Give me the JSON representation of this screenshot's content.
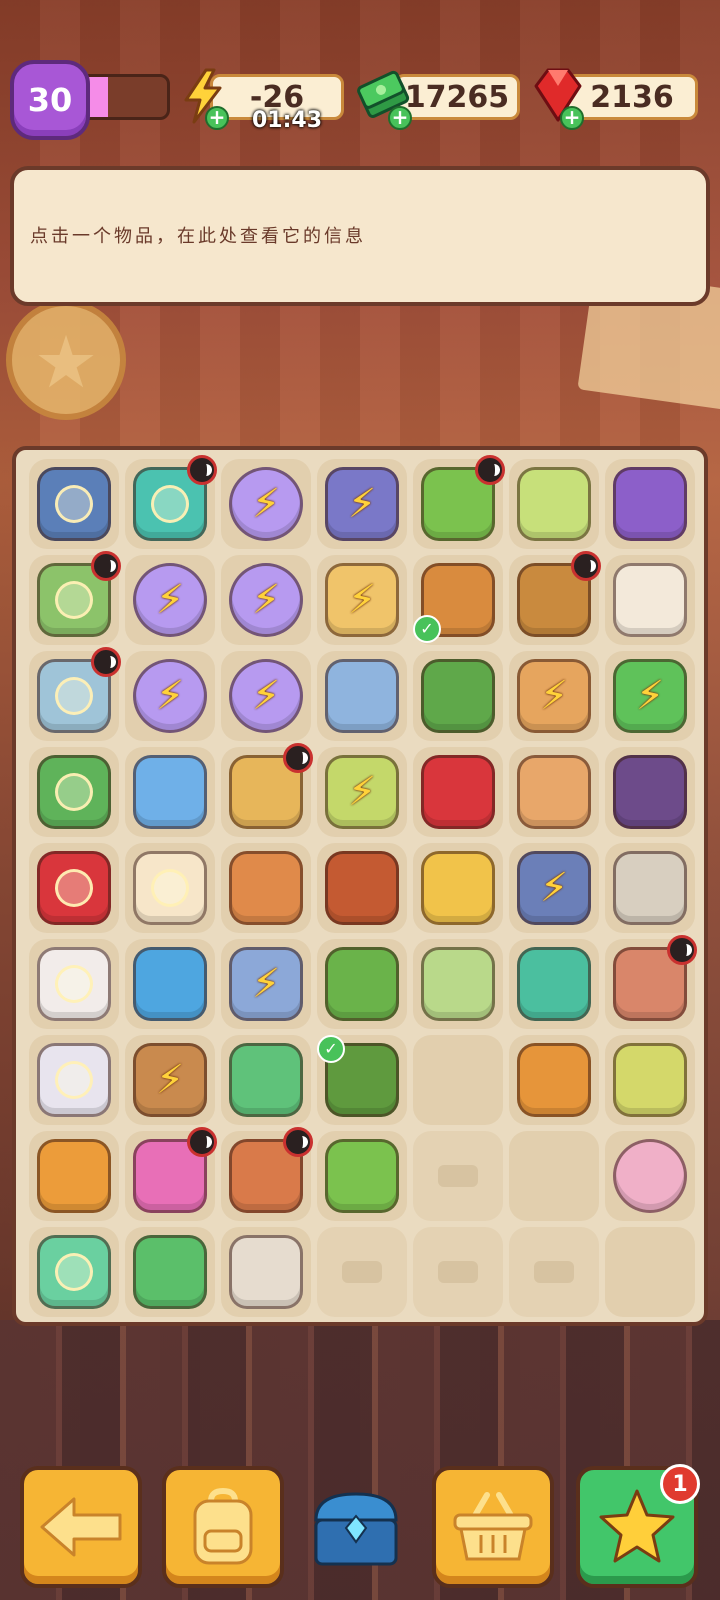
{
  "hud": {
    "level": "30",
    "level_progress": 0.3,
    "energy": "-26",
    "energy_timer": "01:43",
    "cash": "17265",
    "gems": "2136"
  },
  "info": {
    "text": "点击一个物品，在此处查看它的信息"
  },
  "board": {
    "rows": [
      [
        {
          "icon": "truck-icon",
          "color": "#5b7fb8",
          "glow": true
        },
        {
          "icon": "medkit-icon",
          "color": "#4bc2b0",
          "glow": true,
          "lock": true
        },
        {
          "icon": "energy-orb-icon",
          "color": "#b79af0",
          "round": true
        },
        {
          "icon": "energy-crate-icon",
          "color": "#7a78c8"
        },
        {
          "icon": "plant-pot-icon",
          "color": "#7bc24e",
          "lock": true
        },
        {
          "icon": "detergent-bottle-icon",
          "color": "#c7e07a"
        },
        {
          "icon": "spotlight-icon",
          "color": "#8c5fc9"
        }
      ],
      [
        {
          "icon": "board-game-icon",
          "color": "#8cc36a",
          "glow": true,
          "lock": true
        },
        {
          "icon": "energy-orb-icon",
          "color": "#b79af0",
          "round": true
        },
        {
          "icon": "energy-orb-icon",
          "color": "#b79af0",
          "round": true
        },
        {
          "icon": "energy-box-icon",
          "color": "#f0c46a"
        },
        {
          "icon": "binoculars-icon",
          "color": "#d98b3e",
          "check": true
        },
        {
          "icon": "seedling-pot-icon",
          "color": "#c98a3e",
          "lock": true
        },
        {
          "icon": "cards-icon",
          "color": "#f3e9da"
        }
      ],
      [
        {
          "icon": "map-kit-icon",
          "color": "#9fc4d8",
          "glow": true,
          "lock": true
        },
        {
          "icon": "energy-orb-icon",
          "color": "#b79af0",
          "round": true
        },
        {
          "icon": "energy-orb-icon",
          "color": "#b79af0",
          "round": true
        },
        {
          "icon": "vase-icon",
          "color": "#8fb4de"
        },
        {
          "icon": "flower-bush-icon",
          "color": "#5fa84a"
        },
        {
          "icon": "energy-cardboard-box-icon",
          "color": "#e6a55e"
        },
        {
          "icon": "energy-tree-icon",
          "color": "#5fc25a"
        }
      ],
      [
        {
          "icon": "cash-chest-icon",
          "color": "#5fb35a",
          "glow": true
        },
        {
          "icon": "sunglasses-icon",
          "color": "#6fb0e8"
        },
        {
          "icon": "dragon-vase-icon",
          "color": "#e7b65a",
          "lock": true
        },
        {
          "icon": "energy-coin-bag-icon",
          "color": "#c4d86a"
        },
        {
          "icon": "red-tray-icon",
          "color": "#d9363c"
        },
        {
          "icon": "stacked-boxes-icon",
          "color": "#e8a76a"
        },
        {
          "icon": "hair-dryer-icon",
          "color": "#6d4b8a"
        }
      ],
      [
        {
          "icon": "red-toolbox-icon",
          "color": "#d9363c",
          "glow": true
        },
        {
          "icon": "lucky-cat-icon",
          "color": "#f7e6c9",
          "glow": true
        },
        {
          "icon": "hourglass-icon",
          "color": "#e08a4a"
        },
        {
          "icon": "red-panda-icon",
          "color": "#c45a32"
        },
        {
          "icon": "poster-icon",
          "color": "#f1c34a"
        },
        {
          "icon": "energy-tools-icon",
          "color": "#6b7fb8"
        },
        {
          "icon": "evidence-bag-icon",
          "color": "#d8cfc0"
        }
      ],
      [
        {
          "icon": "white-red-kit-icon",
          "color": "#f2ecea",
          "glow": true
        },
        {
          "icon": "scissors-tag-icon",
          "color": "#4ea6e0"
        },
        {
          "icon": "energy-scroll-icon",
          "color": "#8ca8d8"
        },
        {
          "icon": "bonsai-icon",
          "color": "#6ab34a"
        },
        {
          "icon": "soap-bar-icon",
          "color": "#b9d98a"
        },
        {
          "icon": "teal-case-icon",
          "color": "#4bbf9f"
        },
        {
          "icon": "potion-flask-icon",
          "color": "#d9866a",
          "lock": true
        }
      ],
      [
        {
          "icon": "ice-bag-icon",
          "color": "#e8e4ee",
          "glow": true
        },
        {
          "icon": "energy-crate-pots-icon",
          "color": "#c98a4e"
        },
        {
          "icon": "small-tree-icon",
          "color": "#5fc27a"
        },
        {
          "icon": "berry-bush-icon",
          "color": "#5f9a3e",
          "check": true,
          "check_top": true
        },
        {
          "empty": false,
          "blank": true
        },
        {
          "icon": "magnifier-icon",
          "color": "#e6953a"
        },
        {
          "icon": "gold-coin-bag-icon",
          "color": "#d4d86a"
        }
      ],
      [
        {
          "icon": "honey-jar-icon",
          "color": "#ec9c3a"
        },
        {
          "icon": "flower-basket-icon",
          "color": "#e86fb7",
          "lock": true
        },
        {
          "icon": "red-vase-icon",
          "color": "#d97a4a",
          "lock": true
        },
        {
          "icon": "sprout-pot-icon",
          "color": "#7bc24e"
        },
        {
          "empty": true
        },
        {
          "blank": true
        },
        {
          "icon": "rainbow-panda-icon",
          "color": "#f0b0c8",
          "round": true
        }
      ],
      [
        {
          "icon": "crystal-tree-icon",
          "color": "#6ad0a0",
          "glow": true
        },
        {
          "icon": "broom-brush-icon",
          "color": "#5bbf6a"
        },
        {
          "icon": "footprint-bag-icon",
          "color": "#e6dccf"
        },
        {
          "empty": true
        },
        {
          "empty": true
        },
        {
          "empty": true
        },
        {
          "blank": true
        }
      ]
    ]
  },
  "bottom": {
    "notification_count": "1"
  },
  "colors": {
    "accent_yellow": "#f6b534",
    "accent_green": "#42c66a",
    "panel": "#f6e7cd",
    "board": "#eadbc0"
  }
}
